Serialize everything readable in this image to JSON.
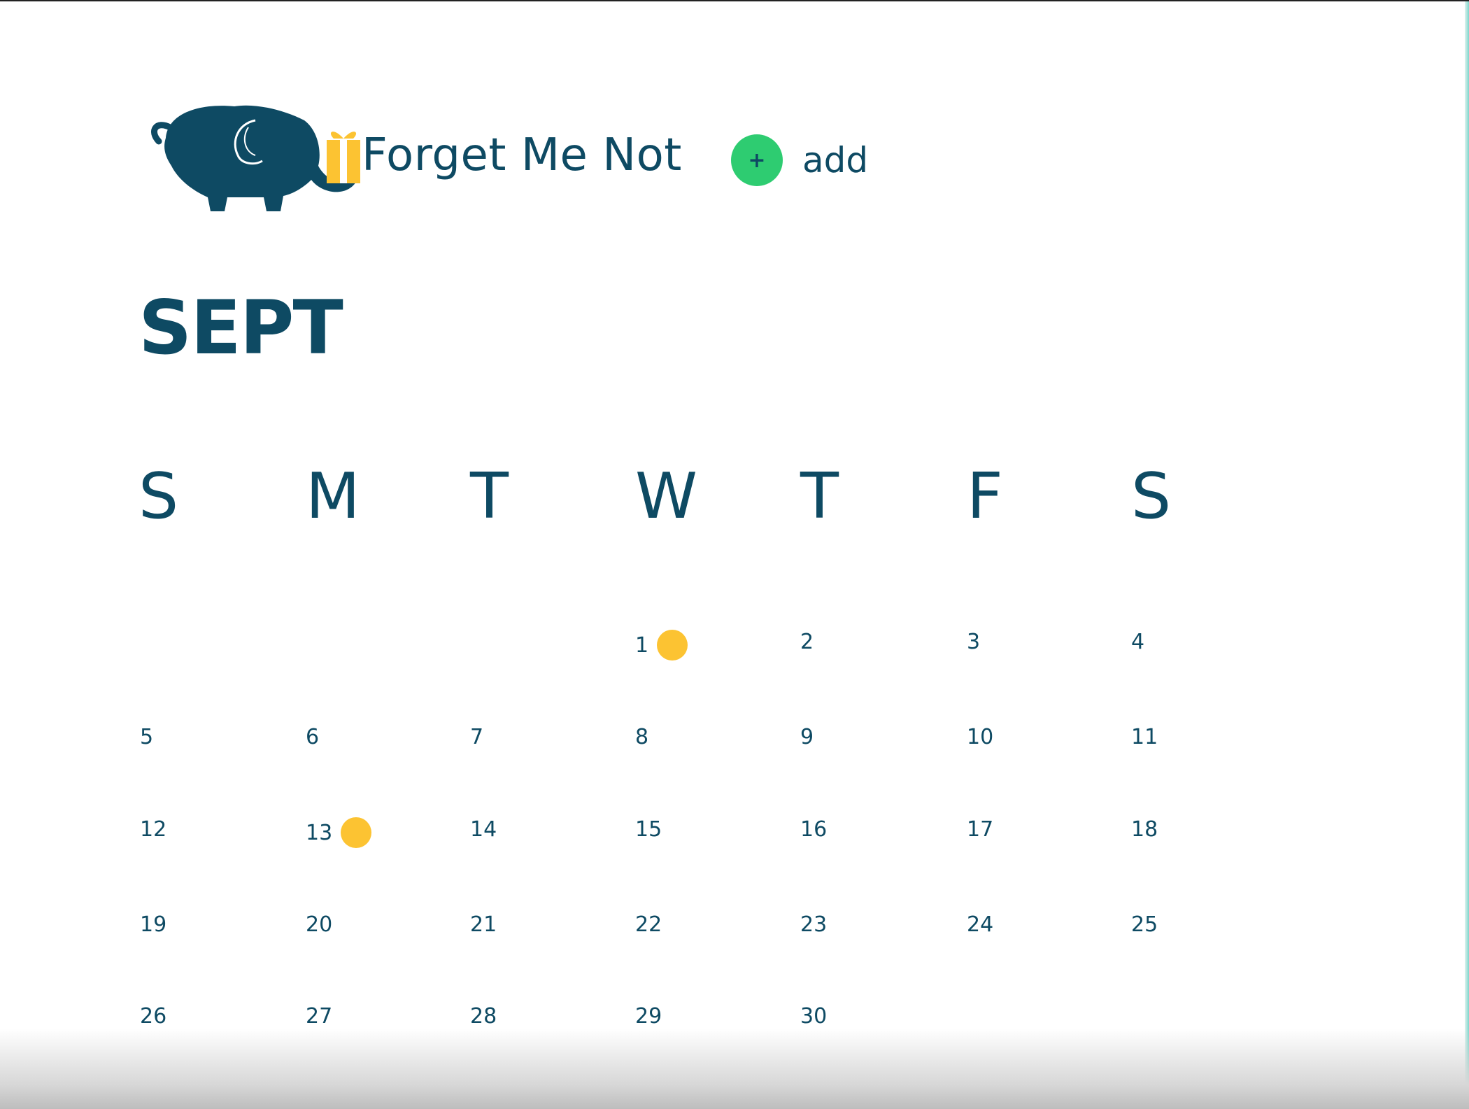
{
  "app": {
    "name": "Forget Me Not",
    "add_label": "add",
    "add_symbol": "+"
  },
  "calendar": {
    "month": "SEPT",
    "weekdays": [
      "S",
      "M",
      "T",
      "W",
      "T",
      "F",
      "S"
    ],
    "days": [
      "1",
      "2",
      "3",
      "4",
      "5",
      "6",
      "7",
      "8",
      "9",
      "10",
      "11",
      "12",
      "13",
      "14",
      "15",
      "16",
      "17",
      "18",
      "19",
      "20",
      "21",
      "22",
      "23",
      "24",
      "25",
      "26",
      "27",
      "28",
      "29",
      "30"
    ],
    "event_days": [
      "1",
      "13"
    ]
  },
  "colors": {
    "primary": "#0e4a63",
    "accent_green": "#2ecc71",
    "event_yellow": "#fcc332"
  },
  "icons": {
    "logo": "elephant-gift-logo-icon",
    "add": "plus-icon",
    "event": "event-dot-icon"
  }
}
